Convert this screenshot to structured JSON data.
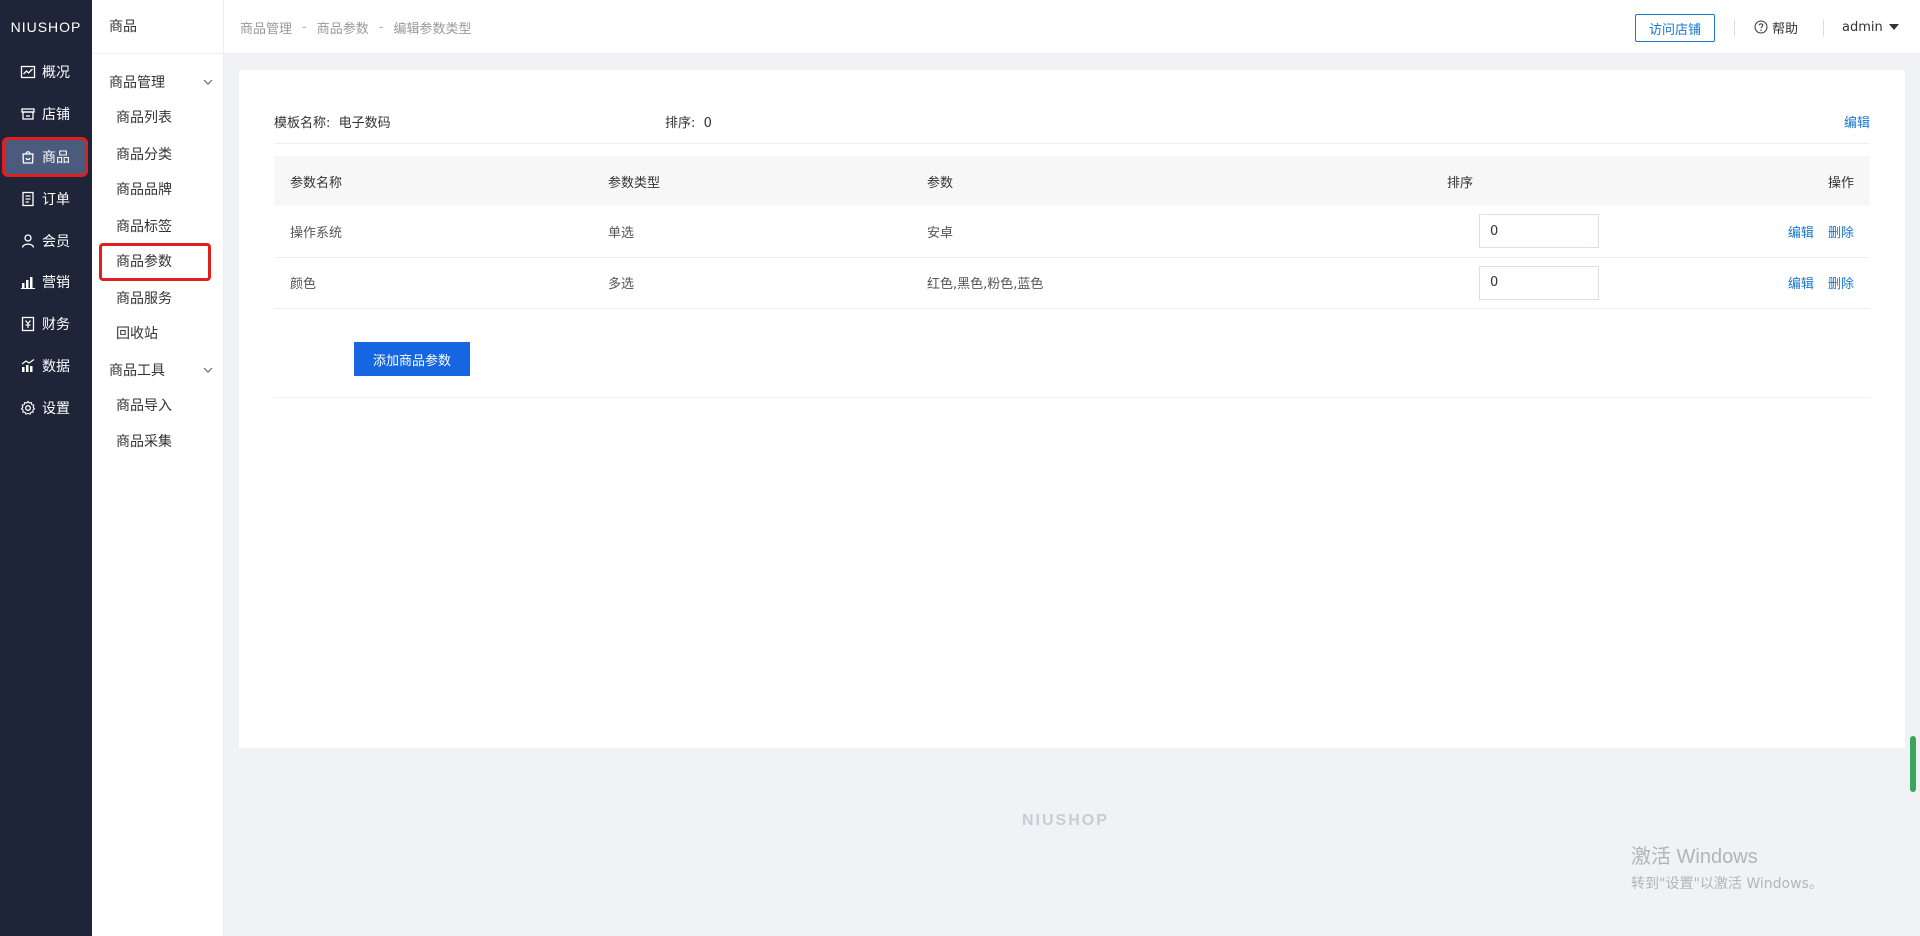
{
  "brand": "NIUSHOP",
  "main_nav": [
    {
      "label": "概况",
      "icon": "chart-icon"
    },
    {
      "label": "店铺",
      "icon": "store-icon"
    },
    {
      "label": "商品",
      "icon": "bag-icon"
    },
    {
      "label": "订单",
      "icon": "order-icon"
    },
    {
      "label": "会员",
      "icon": "user-icon"
    },
    {
      "label": "营销",
      "icon": "bar-chart-icon"
    },
    {
      "label": "财务",
      "icon": "finance-icon"
    },
    {
      "label": "数据",
      "icon": "data-icon"
    },
    {
      "label": "设置",
      "icon": "gear-icon"
    }
  ],
  "sub_nav": {
    "title": "商品",
    "groups": [
      {
        "title": "商品管理",
        "items": [
          "商品列表",
          "商品分类",
          "商品品牌",
          "商品标签",
          "商品参数",
          "商品服务",
          "回收站"
        ]
      },
      {
        "title": "商品工具",
        "items": [
          "商品导入",
          "商品采集"
        ]
      }
    ]
  },
  "breadcrumb": [
    "商品管理",
    "商品参数",
    "编辑参数类型"
  ],
  "breadcrumb_sep": "-",
  "topbar": {
    "visit_store": "访问店铺",
    "help": "帮助",
    "user": "admin"
  },
  "template": {
    "name_label": "模板名称:",
    "name_value": "电子数码",
    "sort_label": "排序:",
    "sort_value": "0",
    "edit": "编辑"
  },
  "table": {
    "headers": [
      "参数名称",
      "参数类型",
      "参数",
      "排序",
      "操作"
    ],
    "rows": [
      {
        "name": "操作系统",
        "type": "单选",
        "values": "安卓",
        "sort": "0"
      },
      {
        "name": "颜色",
        "type": "多选",
        "values": "红色,黑色,粉色,蓝色",
        "sort": "0"
      }
    ],
    "op_edit": "编辑",
    "op_delete": "删除"
  },
  "add_button": "添加商品参数",
  "footer_brand": "NIUSHOP",
  "watermark": {
    "line1": "激活 Windows",
    "line2": "转到\"设置\"以激活 Windows。"
  }
}
